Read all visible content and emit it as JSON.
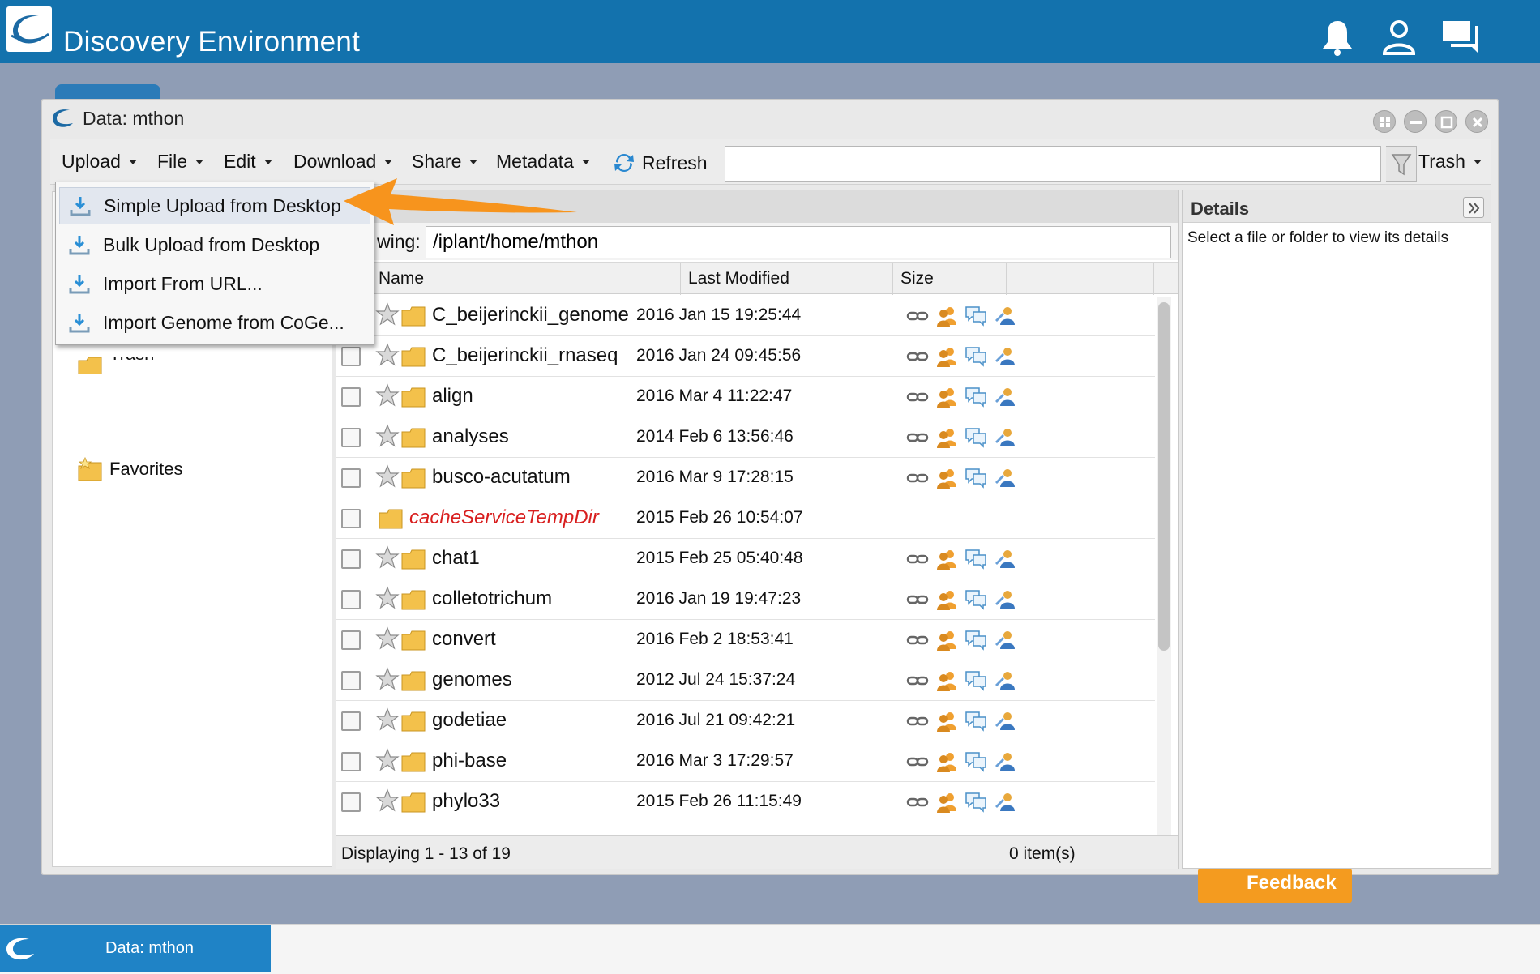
{
  "app": {
    "title": "Discovery Environment"
  },
  "window": {
    "title": "Data: mthon"
  },
  "toolbar": {
    "upload": "Upload",
    "file": "File",
    "edit": "Edit",
    "download": "Download",
    "share": "Share",
    "metadata": "Metadata",
    "refresh": "Refresh",
    "trash": "Trash",
    "search_value": ""
  },
  "upload_menu": {
    "items": [
      {
        "label": "Simple Upload from Desktop",
        "active": true
      },
      {
        "label": "Bulk Upload from Desktop"
      },
      {
        "label": "Import From URL..."
      },
      {
        "label": "Import Genome from CoGe..."
      }
    ]
  },
  "nav": {
    "partial_label": "Trash",
    "favorites": "Favorites"
  },
  "grid": {
    "viewing_label": "wing:",
    "path": "/iplant/home/mthon",
    "columns": {
      "name": "Name",
      "modified": "Last Modified",
      "size": "Size"
    },
    "rows": [
      {
        "name": "C_beijerinckii_genome",
        "modified": "2016 Jan 15 19:25:44",
        "checkbox": false
      },
      {
        "name": "C_beijerinckii_rnaseq",
        "modified": "2016 Jan 24 09:45:56"
      },
      {
        "name": "align",
        "modified": "2016 Mar 4 11:22:47"
      },
      {
        "name": "analyses",
        "modified": "2014 Feb 6 13:56:46"
      },
      {
        "name": "busco-acutatum",
        "modified": "2016 Mar 9 17:28:15"
      },
      {
        "name": "cacheServiceTempDir",
        "modified": "2015 Feb 26 10:54:07",
        "special": true
      },
      {
        "name": "chat1",
        "modified": "2015 Feb 25 05:40:48"
      },
      {
        "name": "colletotrichum",
        "modified": "2016 Jan 19 19:47:23"
      },
      {
        "name": "convert",
        "modified": "2016 Feb 2 18:53:41"
      },
      {
        "name": "genomes",
        "modified": "2012 Jul 24 15:37:24"
      },
      {
        "name": "godetiae",
        "modified": "2016 Jul 21 09:42:21"
      },
      {
        "name": "phi-base",
        "modified": "2016 Mar 3 17:29:57"
      },
      {
        "name": "phylo33",
        "modified": "2015 Feb 26 11:15:49"
      }
    ],
    "status_left": "Displaying 1 - 13 of 19",
    "status_right": "0 item(s)"
  },
  "details": {
    "title": "Details",
    "hint": "Select a file or folder to view its details"
  },
  "feedback": {
    "label": "Feedback"
  },
  "taskbar": {
    "label": "Data: mthon"
  },
  "colors": {
    "topbar": "#1372ad",
    "accent_orange": "#f7941d",
    "special_folder_text": "#d81e1e"
  }
}
